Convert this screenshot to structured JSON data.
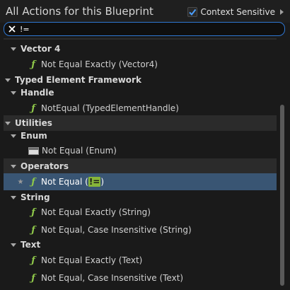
{
  "header": {
    "title": "All Actions for this Blueprint",
    "context_sensitive_label": "Context Sensitive",
    "context_sensitive_checked": true
  },
  "search": {
    "value": "!=",
    "placeholder": ""
  },
  "items": {
    "vector4_cat": "Vector 4",
    "vector4_fn": "Not Equal Exactly (Vector4)",
    "typed_cat": "Typed Element Framework",
    "handle_cat": "Handle",
    "handle_fn": "NotEqual (TypedElementHandle)",
    "utilities_cat": "Utilities",
    "enum_cat": "Enum",
    "enum_fn": "Not Equal (Enum)",
    "operators_cat": "Operators",
    "operators_fn_prefix": "Not Equal (",
    "operators_fn_highlight": "!=",
    "operators_fn_suffix": ")",
    "string_cat": "String",
    "string_fn1": "Not Equal Exactly (String)",
    "string_fn2": "Not Equal, Case Insensitive (String)",
    "text_cat": "Text",
    "text_fn1": "Not Equal Exactly (Text)",
    "text_fn2": "Not Equal, Case Insensitive (Text)"
  },
  "icons": {
    "function": "function-icon",
    "enum": "enum-icon",
    "favorite": "star-icon"
  },
  "colors": {
    "accent": "#2f77d3",
    "selected_row": "#395573",
    "function_icon": "#8fc84a",
    "match_highlight": "#86b53a"
  }
}
